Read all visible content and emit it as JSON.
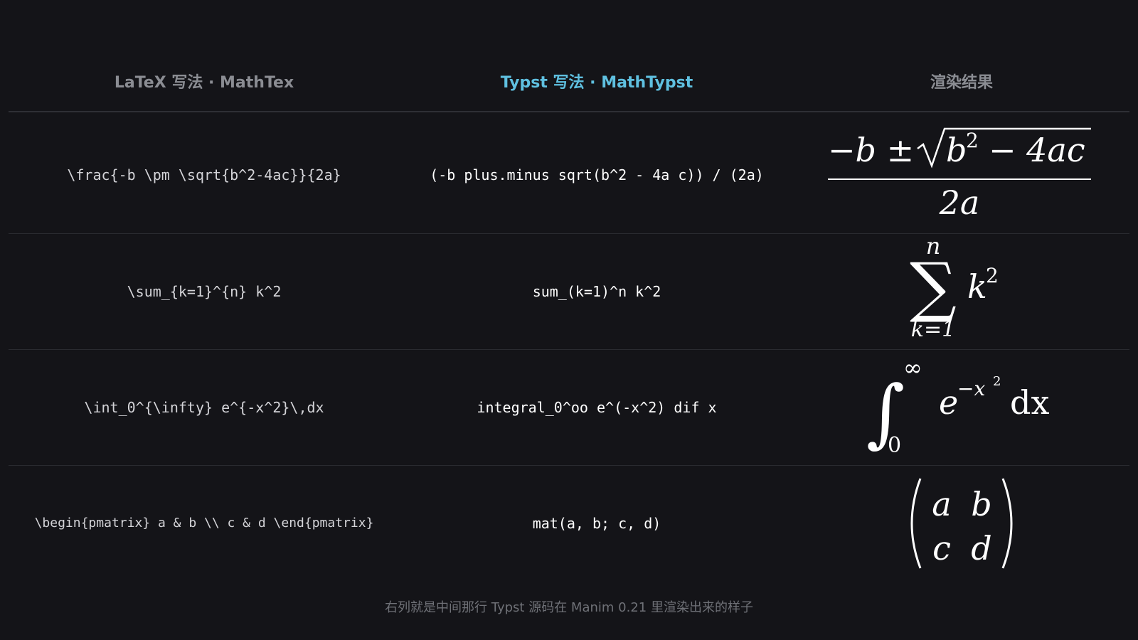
{
  "headers": {
    "latex": "LaTeX 写法 · MathTex",
    "typst": "Typst 写法 · MathTypst",
    "render": "渲染结果"
  },
  "rows": [
    {
      "latex": "\\frac{-b \\pm \\sqrt{b^2-4ac}}{2a}",
      "typst": "(-b plus.minus sqrt(b^2 - 4a c)) / (2a)",
      "render": {
        "numerator_lead": "−b ±",
        "radicand_base": "b",
        "radicand_exp": "2",
        "radicand_rest": "− 4ac",
        "denominator": "2a"
      }
    },
    {
      "latex": "\\sum_{k=1}^{n} k^2",
      "typst": "sum_(k=1)^n k^2",
      "render": {
        "symbol": "∑",
        "upper": "n",
        "lower": "k=1",
        "term_base": "k",
        "term_exp": "2"
      }
    },
    {
      "latex": "\\int_0^{\\infty} e^{-x^2}\\,dx",
      "typst": "integral_0^oo e^(-x^2) dif x",
      "render": {
        "symbol": "∫",
        "upper": "∞",
        "lower": "0",
        "base": "e",
        "exp": "−x",
        "exp_exp": "2",
        "differential": "dx"
      }
    },
    {
      "latex": "\\begin{pmatrix} a & b \\\\ c & d \\end{pmatrix}",
      "typst": "mat(a, b; c, d)",
      "render": {
        "cells": [
          [
            "a",
            "b"
          ],
          [
            "c",
            "d"
          ]
        ]
      }
    }
  ],
  "footnote": "右列就是中间那行 Typst 源码在 Manim 0.21 里渲染出来的样子"
}
